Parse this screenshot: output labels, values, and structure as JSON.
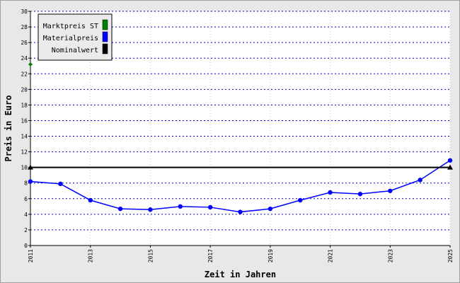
{
  "chart_data": {
    "type": "line",
    "title": "",
    "xlabel": "Zeit in Jahren",
    "ylabel": "Preis in Euro",
    "xlim": [
      2011,
      2025
    ],
    "ylim": [
      0,
      30
    ],
    "x_ticks": [
      2011,
      2013,
      2015,
      2017,
      2019,
      2021,
      2023,
      2025
    ],
    "y_ticks": [
      0,
      2,
      4,
      6,
      8,
      10,
      12,
      14,
      16,
      18,
      20,
      22,
      24,
      26,
      28,
      30
    ],
    "grid": true,
    "legend_position": "top-left",
    "series": [
      {
        "name": "Marktpreis ST",
        "color": "#008000",
        "x": [
          2011
        ],
        "values": [
          23.2
        ]
      },
      {
        "name": "Materialpreis",
        "color": "#0000ff",
        "x": [
          2011,
          2012,
          2013,
          2014,
          2015,
          2016,
          2017,
          2018,
          2019,
          2020,
          2021,
          2022,
          2023,
          2024,
          2025
        ],
        "values": [
          8.2,
          7.9,
          5.8,
          4.7,
          4.6,
          5.0,
          4.9,
          4.3,
          4.7,
          5.8,
          6.8,
          6.6,
          7.0,
          8.4,
          10.9
        ]
      },
      {
        "name": "Nominalwert",
        "color": "#000000",
        "x": [
          2011,
          2025
        ],
        "values": [
          10,
          10
        ]
      }
    ]
  }
}
